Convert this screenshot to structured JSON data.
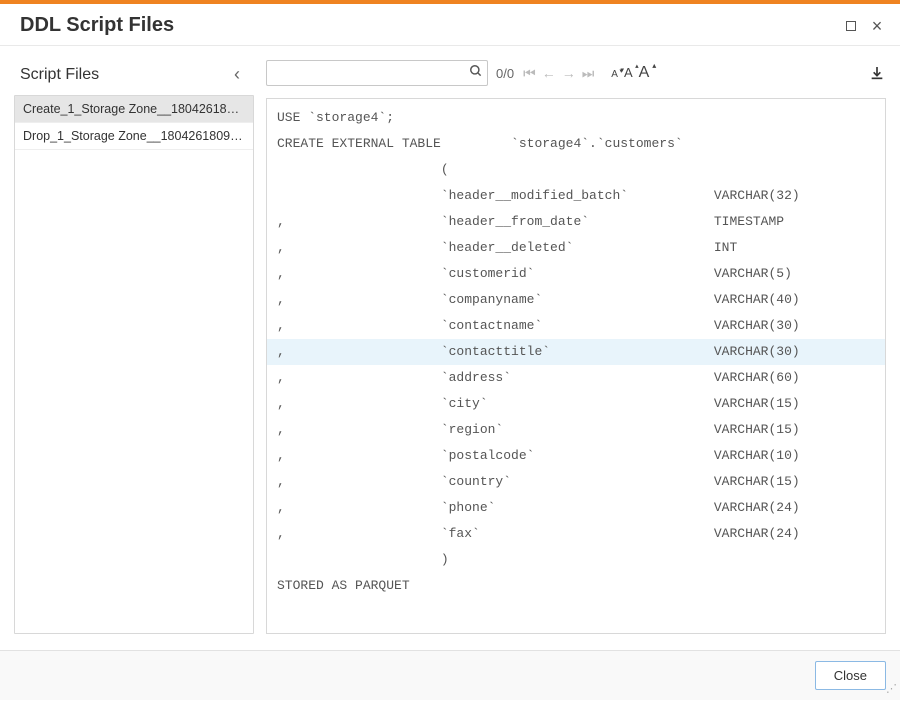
{
  "window": {
    "title": "DDL Script Files"
  },
  "sidebar": {
    "header": "Script Files",
    "items": [
      {
        "label": "Create_1_Storage Zone__18042618093...",
        "selected": true
      },
      {
        "label": "Drop_1_Storage Zone__180426180906...",
        "selected": false
      }
    ]
  },
  "toolbar": {
    "search_placeholder": "",
    "counter": "0/0"
  },
  "code_lines": [
    {
      "text": "USE `storage4`;",
      "hl": false
    },
    {
      "text": "",
      "hl": false
    },
    {
      "text": "CREATE EXTERNAL TABLE         `storage4`.`customers`",
      "hl": false
    },
    {
      "text": "                     (",
      "hl": false
    },
    {
      "text": "                     `header__modified_batch`           VARCHAR(32)",
      "hl": false
    },
    {
      "text": ",                    `header__from_date`                TIMESTAMP",
      "hl": false
    },
    {
      "text": ",                    `header__deleted`                  INT",
      "hl": false
    },
    {
      "text": ",                    `customerid`                       VARCHAR(5)",
      "hl": false
    },
    {
      "text": ",                    `companyname`                      VARCHAR(40)",
      "hl": false
    },
    {
      "text": ",                    `contactname`                      VARCHAR(30)",
      "hl": false
    },
    {
      "text": ",                    `contacttitle`                     VARCHAR(30)",
      "hl": true
    },
    {
      "text": ",                    `address`                          VARCHAR(60)",
      "hl": false
    },
    {
      "text": ",                    `city`                             VARCHAR(15)",
      "hl": false
    },
    {
      "text": ",                    `region`                           VARCHAR(15)",
      "hl": false
    },
    {
      "text": ",                    `postalcode`                       VARCHAR(10)",
      "hl": false
    },
    {
      "text": ",                    `country`                          VARCHAR(15)",
      "hl": false
    },
    {
      "text": ",                    `phone`                            VARCHAR(24)",
      "hl": false
    },
    {
      "text": ",                    `fax`                              VARCHAR(24)",
      "hl": false
    },
    {
      "text": "                     )",
      "hl": false
    },
    {
      "text": "",
      "hl": false
    },
    {
      "text": "STORED AS PARQUET",
      "hl": false
    }
  ],
  "footer": {
    "close_label": "Close"
  }
}
